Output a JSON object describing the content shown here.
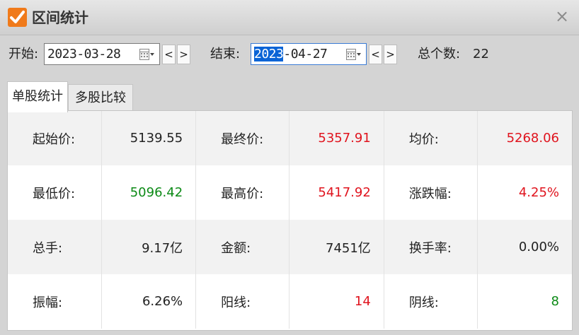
{
  "window": {
    "title": "区间统计",
    "close_glyph": "×"
  },
  "controls": {
    "start_label": "开始:",
    "start_date": "2023-03-28",
    "end_label": "结束:",
    "end_date_selected": "2023",
    "end_date_rest": "-04-27",
    "prev_glyph": "<",
    "next_glyph": ">",
    "count_label": "总个数:",
    "count_value": "22"
  },
  "tabs": [
    {
      "label": "单股统计",
      "active": true
    },
    {
      "label": "多股比较",
      "active": false
    }
  ],
  "stats": {
    "start_price": {
      "label": "起始价:",
      "value": "5139.55"
    },
    "final_price": {
      "label": "最终价:",
      "value": "5357.91"
    },
    "avg_price": {
      "label": "均价:",
      "value": "5268.06"
    },
    "low_price": {
      "label": "最低价:",
      "value": "5096.42"
    },
    "high_price": {
      "label": "最高价:",
      "value": "5417.92"
    },
    "change_pct": {
      "label": "涨跌幅:",
      "value": "4.25%"
    },
    "volume": {
      "label": "总手:",
      "value": "9.17亿"
    },
    "amount": {
      "label": "金额:",
      "value": "7451亿"
    },
    "turnover": {
      "label": "换手率:",
      "value": "0.00%"
    },
    "amplitude": {
      "label": "振幅:",
      "value": "6.26%"
    },
    "up_days": {
      "label": "阳线:",
      "value": "14"
    },
    "down_days": {
      "label": "阴线:",
      "value": "8"
    }
  },
  "colors": {
    "up": "#e0141e",
    "down": "#0c8a16",
    "accent": "#f07a1a",
    "selection": "#0a64d6"
  }
}
